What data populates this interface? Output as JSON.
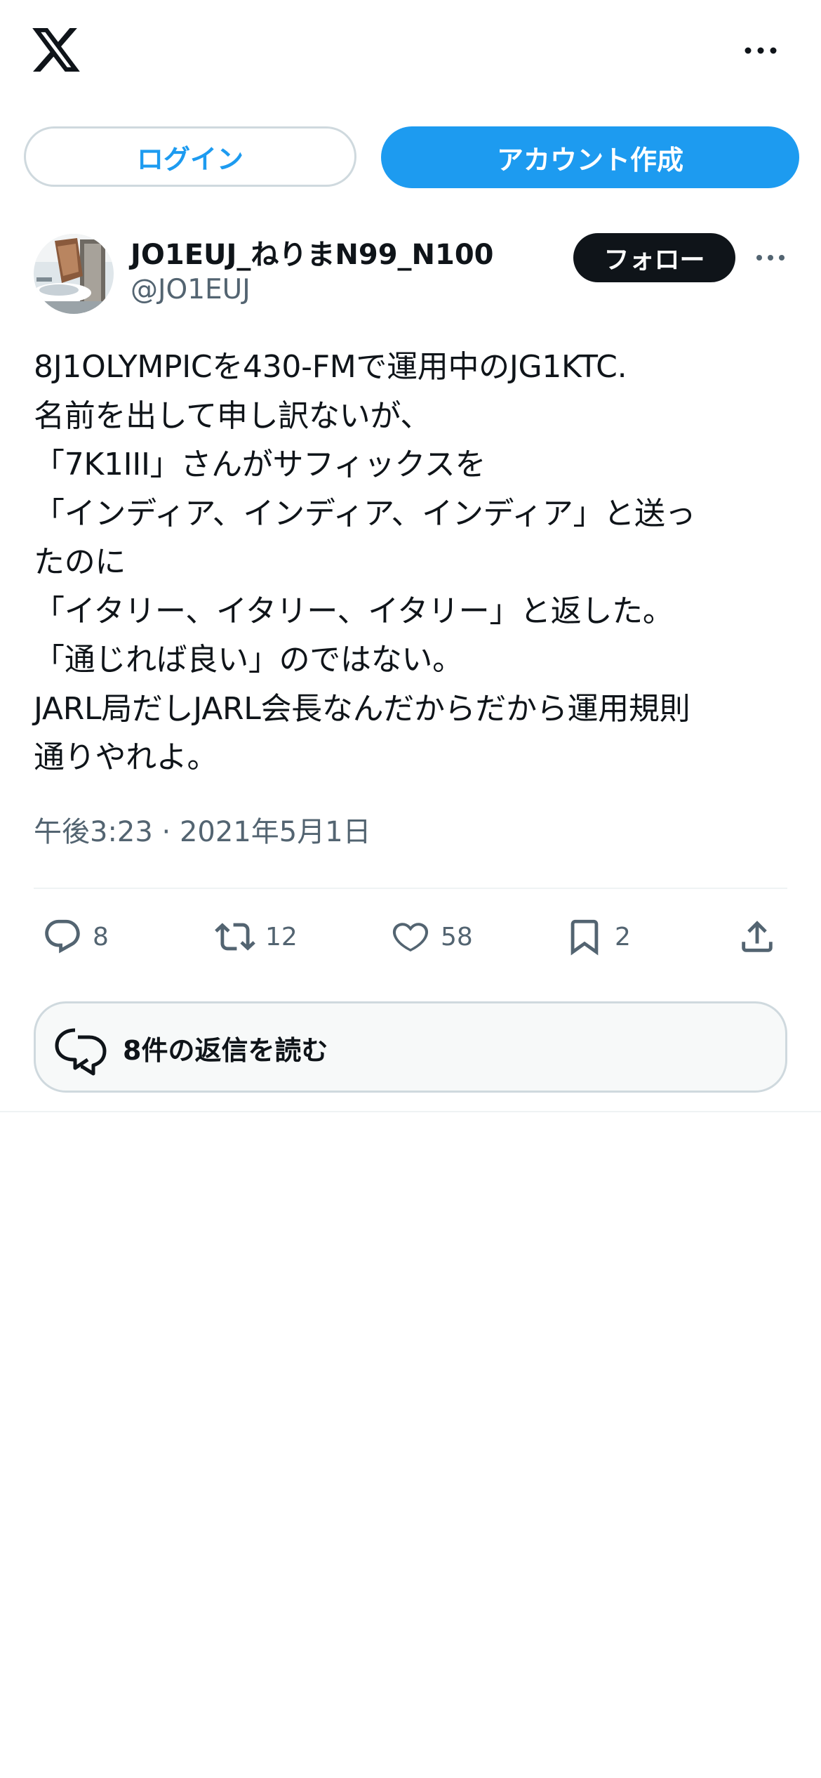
{
  "header": {
    "logo_icon": "x-logo-icon",
    "more_icon": "more-horizontal-icon"
  },
  "auth": {
    "login_label": "ログイン",
    "signup_label": "アカウント作成"
  },
  "author": {
    "display_name": "JO1EUJ_ねりまN99_N100",
    "handle": "@JO1EUJ",
    "follow_label": "フォロー"
  },
  "tweet": {
    "text": "8J1OLYMPICを430-FMで運用中のJG1KTC.\n名前を出して申し訳ないが、\n「7K1III」さんがサフィックスを\n「インディア、インディア、インディア」と送っ\nたのに\n「イタリー、イタリー、イタリー」と返した。\n「通じれば良い」のではない。\nJARL局だしJARL会長なんだからだから運用規則\n通りやれよ。",
    "timestamp": "午後3:23 · 2021年5月1日"
  },
  "actions": {
    "replies": "8",
    "retweets": "12",
    "likes": "58",
    "bookmarks": "2"
  },
  "read_replies_label": "8件の返信を読む",
  "colors": {
    "accent": "#1d9bf0",
    "text": "#0f1419",
    "secondary": "#536471",
    "border": "#cfd9de"
  }
}
